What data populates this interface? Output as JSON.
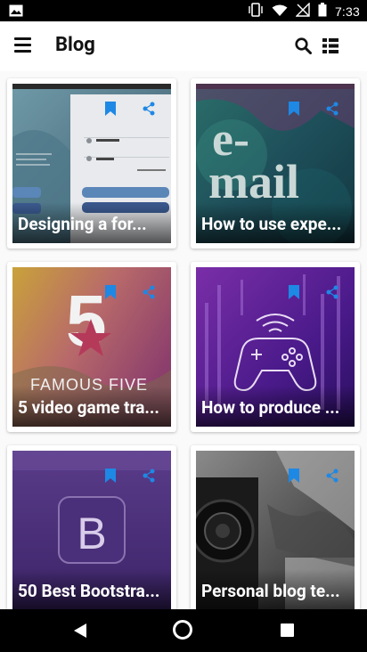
{
  "status_bar": {
    "time": "7:33",
    "icons": [
      "image-icon",
      "vibrate-icon",
      "wifi-icon",
      "signal-off-icon",
      "battery-icon"
    ]
  },
  "app_bar": {
    "title": "Blog",
    "icons": [
      "menu-icon",
      "search-icon",
      "view-list-icon"
    ]
  },
  "posts": [
    {
      "title": "Designing a for...",
      "thumbnail": "login form screenshot",
      "bookmarked": true
    },
    {
      "title": "How to use expe...",
      "thumbnail": "e-mail teal graphic",
      "bookmarked": true
    },
    {
      "title": "5 video game tra...",
      "thumbnail": "5 Famous Five logo",
      "bookmarked": true
    },
    {
      "title": "How to produce ...",
      "thumbnail": "gamepad neon purple",
      "bookmarked": true
    },
    {
      "title": "50 Best Bootstra...",
      "thumbnail": "Bootstrap B logo",
      "bookmarked": true
    },
    {
      "title": "Personal blog te...",
      "thumbnail": "camera black and white",
      "bookmarked": true
    }
  ],
  "colors": {
    "accent": "#1e88e5",
    "text": "#111111",
    "background": "#fafafa"
  },
  "nav_bar": {
    "icons": [
      "back-icon",
      "home-icon",
      "recents-icon"
    ]
  }
}
